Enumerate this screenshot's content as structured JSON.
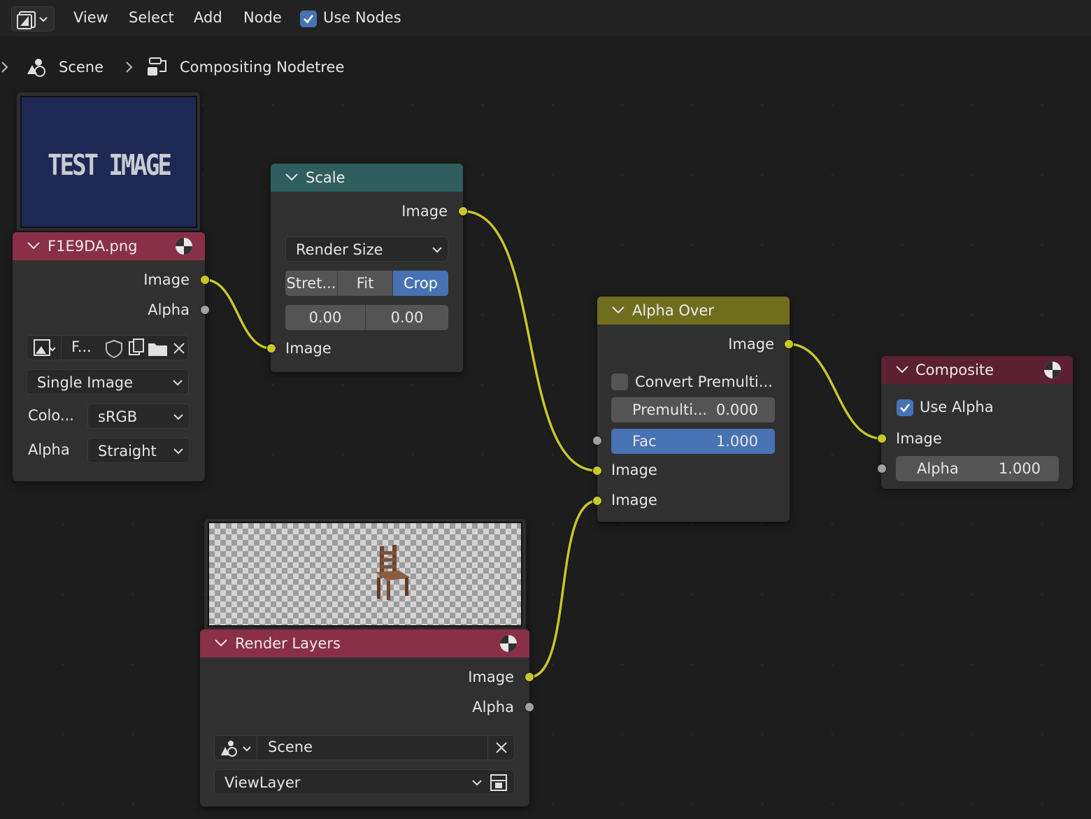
{
  "header": {
    "editor_icon": "node-editor-icon",
    "menus": [
      "View",
      "Select",
      "Add",
      "Node"
    ],
    "use_nodes_label": "Use Nodes",
    "use_nodes_checked": true
  },
  "breadcrumb": {
    "scene_label": "Scene",
    "tree_label": "Compositing Nodetree"
  },
  "colors": {
    "input_header": "#8a2f48",
    "converter_header": "#2f5e5e",
    "mix_header": "#6e6e1e",
    "output_header": "#5b2133",
    "socket_image": "#c7c729",
    "socket_value": "#a1a1a1",
    "accent": "#4772b3"
  },
  "nodes": {
    "image": {
      "title": "F1E9DA.png",
      "preview_text": "TEST IMAGE",
      "out_image": "Image",
      "out_alpha": "Alpha",
      "file_label": "F...",
      "source": "Single Image",
      "color_label": "Colo...",
      "color_value": "sRGB",
      "alpha_label": "Alpha",
      "alpha_value": "Straight"
    },
    "scale": {
      "title": "Scale",
      "out_image": "Image",
      "space": "Render Size",
      "modes": [
        "Stret...",
        "Fit",
        "Crop"
      ],
      "active_mode": "Crop",
      "offset_x": "0.00",
      "offset_y": "0.00",
      "in_image": "Image"
    },
    "alpha_over": {
      "title": "Alpha Over",
      "out_image": "Image",
      "convert_label": "Convert Premulti...",
      "convert_checked": false,
      "premul_label": "Premulti...",
      "premul_value": "0.000",
      "fac_label": "Fac",
      "fac_value": "1.000",
      "fac_level": 1.0,
      "in_image_1": "Image",
      "in_image_2": "Image"
    },
    "composite": {
      "title": "Composite",
      "use_alpha_label": "Use Alpha",
      "use_alpha_checked": true,
      "in_image": "Image",
      "alpha_label": "Alpha",
      "alpha_value": "1.000"
    },
    "render_layers": {
      "title": "Render Layers",
      "out_image": "Image",
      "out_alpha": "Alpha",
      "scene": "Scene",
      "view_layer": "ViewLayer"
    }
  }
}
